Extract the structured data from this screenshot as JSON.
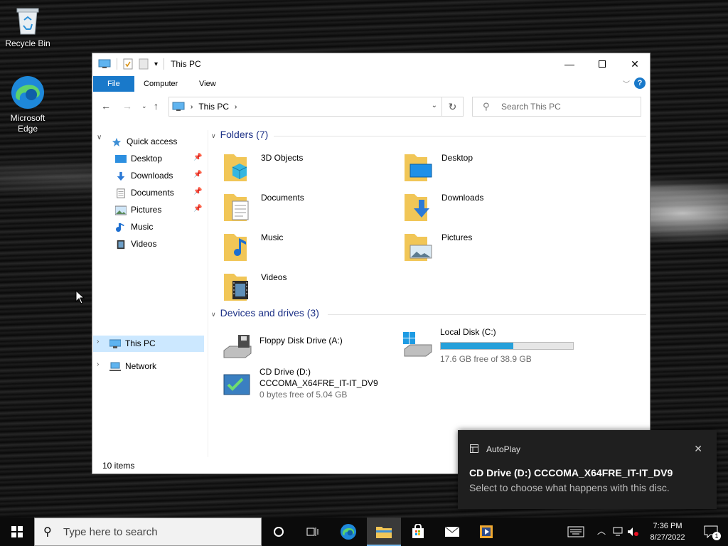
{
  "desktop": {
    "icons": [
      {
        "label": "Recycle Bin",
        "icon": "recycle-bin-icon"
      },
      {
        "label": "Microsoft Edge",
        "icon": "edge-icon"
      }
    ]
  },
  "window": {
    "title": "This PC",
    "ribbon_tabs": [
      "File",
      "Computer",
      "View"
    ],
    "address": {
      "root": "This PC"
    },
    "search_placeholder": "Search This PC",
    "status": "10 items"
  },
  "nav_pane": {
    "quick_access": "Quick access",
    "items": [
      {
        "label": "Desktop",
        "icon": "desktop-icon",
        "pinned": true
      },
      {
        "label": "Downloads",
        "icon": "downloads-icon",
        "pinned": true
      },
      {
        "label": "Documents",
        "icon": "documents-icon",
        "pinned": true
      },
      {
        "label": "Pictures",
        "icon": "pictures-icon",
        "pinned": true
      },
      {
        "label": "Music",
        "icon": "music-icon",
        "pinned": false
      },
      {
        "label": "Videos",
        "icon": "videos-icon",
        "pinned": false
      }
    ],
    "this_pc": "This PC",
    "network": "Network"
  },
  "content": {
    "folders_header": "Folders (7)",
    "folders": [
      {
        "label": "3D Objects",
        "icon": "3d-objects-icon"
      },
      {
        "label": "Desktop",
        "icon": "desktop-icon"
      },
      {
        "label": "Documents",
        "icon": "documents-icon"
      },
      {
        "label": "Downloads",
        "icon": "downloads-icon"
      },
      {
        "label": "Music",
        "icon": "music-icon"
      },
      {
        "label": "Pictures",
        "icon": "pictures-icon"
      },
      {
        "label": "Videos",
        "icon": "videos-icon"
      }
    ],
    "drives_header": "Devices and drives (3)",
    "drives": {
      "floppy": {
        "label": "Floppy Disk Drive (A:)"
      },
      "local": {
        "label": "Local Disk (C:)",
        "free": "17.6 GB free of 38.9 GB",
        "used_fraction": 0.55
      },
      "cd": {
        "label": "CD Drive (D:)",
        "volume": "CCCOMA_X64FRE_IT-IT_DV9",
        "free": "0 bytes free of 5.04 GB"
      }
    }
  },
  "toast": {
    "app": "AutoPlay",
    "title": "CD Drive (D:) CCCOMA_X64FRE_IT-IT_DV9",
    "body": "Select to choose what happens with this disc."
  },
  "taskbar": {
    "search_placeholder": "Type here to search",
    "time": "7:36 PM",
    "date": "8/27/2022",
    "notification_count": "1"
  },
  "colors": {
    "accent": "#1979ca",
    "selection": "#cce8ff",
    "bar_fill": "#26a0da",
    "header_text": "#1e3287"
  }
}
